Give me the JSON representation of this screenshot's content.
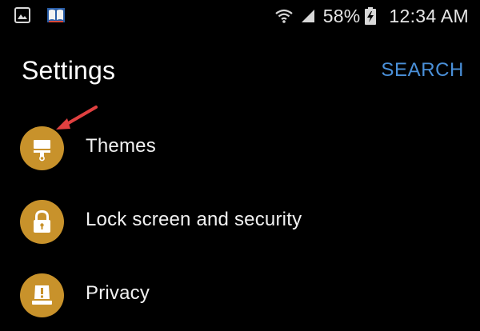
{
  "status_bar": {
    "left_icons": [
      "gallery-icon",
      "book-icon"
    ],
    "battery_percent": "58%",
    "time": "12:34 AM",
    "icons": [
      "wifi-icon",
      "signal-icon",
      "battery-charging-icon"
    ]
  },
  "header": {
    "title": "Settings",
    "search_label": "SEARCH"
  },
  "settings": {
    "items": [
      {
        "label": "Themes",
        "icon": "paint-roller-icon"
      },
      {
        "label": "Lock screen and security",
        "icon": "lock-icon"
      },
      {
        "label": "Privacy",
        "icon": "privacy-shield-icon"
      }
    ]
  },
  "colors": {
    "background": "#000000",
    "accent_icon": "#c8922b",
    "search": "#4a90d9",
    "annotation_arrow": "#e04040"
  }
}
